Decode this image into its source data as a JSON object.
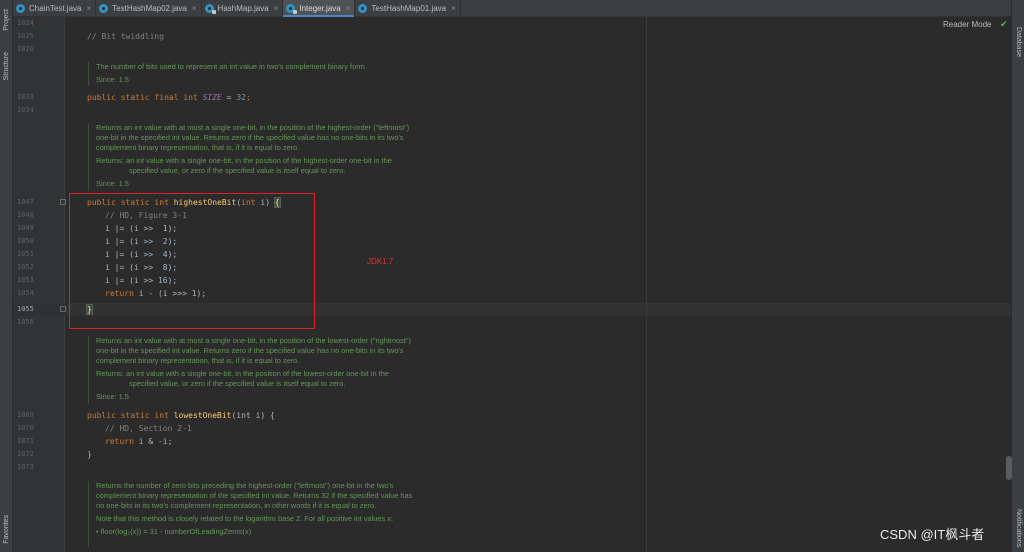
{
  "tabs": [
    {
      "label": "ChainTest.java",
      "close": "×",
      "active": false,
      "locked": false
    },
    {
      "label": "TestHashMap02.java",
      "close": "×",
      "active": false,
      "locked": false
    },
    {
      "label": "HashMap.java",
      "close": "×",
      "active": false,
      "locked": true
    },
    {
      "label": "Integer.java",
      "close": "×",
      "active": true,
      "locked": true
    },
    {
      "label": "TestHashMap01.java",
      "close": "×",
      "active": false,
      "locked": false
    }
  ],
  "left_sidebar": {
    "project": "Project",
    "structure": "Structure",
    "favorites": "Favorites"
  },
  "right_sidebar": {
    "database": "Database",
    "notifications": "Notifications"
  },
  "reader_mode": "Reader Mode",
  "line_numbers": {
    "l1024": "1024",
    "l1025": "1025",
    "l1026": "1026",
    "l1033": "1033",
    "l1034": "1034",
    "l1047": "1047",
    "l1048": "1048",
    "l1049": "1049",
    "l1050": "1050",
    "l1051": "1051",
    "l1052": "1052",
    "l1053": "1053",
    "l1054": "1054",
    "l1055": "1055",
    "l1056": "1056",
    "l1069": "1069",
    "l1070": "1070",
    "l1071": "1071",
    "l1072": "1072",
    "l1073": "1073"
  },
  "code": {
    "bit_twiddling": "// Bit twiddling",
    "size_kw": "public static final int ",
    "size_name": "SIZE",
    "size_eq": " = ",
    "size_val": "32",
    "size_end": ";",
    "hob_kw": "public static int ",
    "hob_name": "highestOneBit",
    "hob_params_kw": "int",
    "hob_params": " i) ",
    "hob_open": "(",
    "hob_brace": "{",
    "hob_comment": "// HD, Figure 3-1",
    "shift_1": "i |= (i >>  1);",
    "shift_2": "i |= (i >>  2);",
    "shift_4": "i |= (i >>  4);",
    "shift_8": "i |= (i >>  8);",
    "shift_16": "i |= (i >> 16);",
    "hob_return_kw": "return ",
    "hob_return": "i - (i >>> 1);",
    "close_brace": "}",
    "lob_kw": "public static int ",
    "lob_name": "lowestOneBit",
    "lob_params": "(int i) {",
    "lob_comment": "// HD, Section 2-1",
    "lob_return_kw": "return ",
    "lob_return": "i & -i;",
    "lob_close": "}"
  },
  "docs": {
    "size_doc": "The number of bits used to represent an int value in two's complement binary form.",
    "size_since": "Since: 1.5",
    "hob_doc_1": "Returns an int value with at most a single one-bit, in the position of the highest-order (\"leftmost\")",
    "hob_doc_2": "one-bit in the specified int value. Returns zero if the specified value has no one-bits in its two's",
    "hob_doc_3": "complement binary representation, that is, if it is equal to zero.",
    "hob_returns_1": "Returns: an int value with a single one-bit, in the position of the highest-order one-bit in the",
    "hob_returns_2": "specified value, or zero if the specified value is itself equal to zero.",
    "hob_since": "Since:    1.5",
    "lob_doc_1": "Returns an int value with at most a single one-bit, in the position of the lowest-order (\"rightmost\")",
    "lob_doc_2": "one-bit in the specified int value. Returns zero if the specified value has no one-bits in its two's",
    "lob_doc_3": "complement binary representation, that is, if it is equal to zero.",
    "lob_returns_1": "Returns: an int value with a single one-bit, in the position of the lowest-order one-bit in the",
    "lob_returns_2": "specified value, or zero if the specified value is itself equal to zero.",
    "lob_since": "Since:    1.5",
    "nlz_doc_1": "Returns the number of zero bits preceding the highest-order (\"leftmost\") one-bit in the two's",
    "nlz_doc_2": "complement binary representation of the specified int value. Returns 32 if the specified value has",
    "nlz_doc_3": "no one-bits in its two's complement representation, in other words if it is equal to zero.",
    "nlz_doc_4": "Note that this method is closely related to the logarithm base 2. For all positive int values x:",
    "nlz_doc_5": "• floor(log₂(x)) = 31 - numberOfLeadingZeros(x)"
  },
  "annotation": {
    "jdk_label": "JDK1.7"
  },
  "watermark": "CSDN @IT枫斗者",
  "colors": {
    "annotation_red": "#e02020",
    "keyword": "#cc7832",
    "doc_green": "#629755",
    "number": "#6897bb"
  }
}
